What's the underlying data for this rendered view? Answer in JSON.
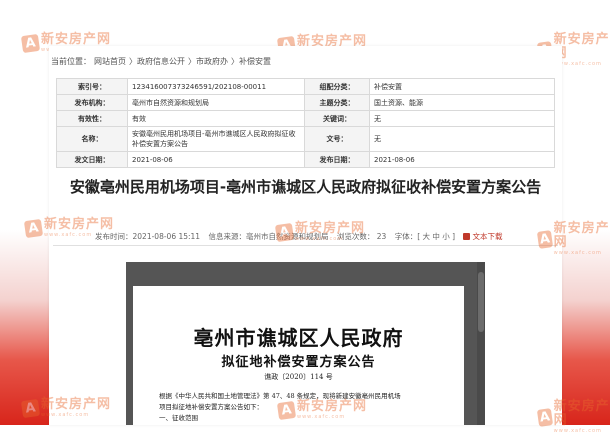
{
  "watermark": {
    "logo": "A",
    "name": "新安房产网",
    "url": "www.xafc.com"
  },
  "breadcrumb": [
    "当前位置：",
    "网站首页",
    "〉政府信息公开",
    "〉市政府办",
    "〉补偿安置"
  ],
  "meta": {
    "rows": [
      {
        "k1": "索引号：",
        "v1": "123416007373246591/202108-00011",
        "k2": "组配分类：",
        "v2": "补偿安置"
      },
      {
        "k1": "发布机构：",
        "v1": "亳州市自然资源和规划局",
        "k2": "主题分类：",
        "v2": "国土资源、能源"
      },
      {
        "k1": "有效性：",
        "v1": "有效",
        "k2": "关键词：",
        "v2": "无"
      },
      {
        "k1": "名称：",
        "v1": "安徽亳州民用机场项目-亳州市谯城区人民政府拟征收补偿安置方案公告",
        "k2": "文号：",
        "v2": "无"
      },
      {
        "k1": "发文日期：",
        "v1": "2021-08-06",
        "k2": "发布日期：",
        "v2": "2021-08-06"
      }
    ]
  },
  "article": {
    "title": "安徽亳州民用机场项目-亳州市谯城区人民政府拟征收补偿安置方案公告",
    "publish_time": "发布时间：2021-08-06 15:11",
    "source": "信息来源：亳州市自然资源和规划局",
    "views": "浏览次数： 23",
    "font_size": "字体：[ 大 中 小 ]",
    "download": "文本下载"
  },
  "document": {
    "heading1": "亳州市谯城区人民政府",
    "heading2": "拟征地补偿安置方案公告",
    "number": "谯政〔2020〕114 号",
    "body_line1": "根据《中华人民共和国土地管理法》第 47、48 条规定，现将新建安徽亳州民用机场",
    "body_line2": "项目拟征地补偿安置方案公告如下：",
    "body_line3": "一、征收范围"
  }
}
